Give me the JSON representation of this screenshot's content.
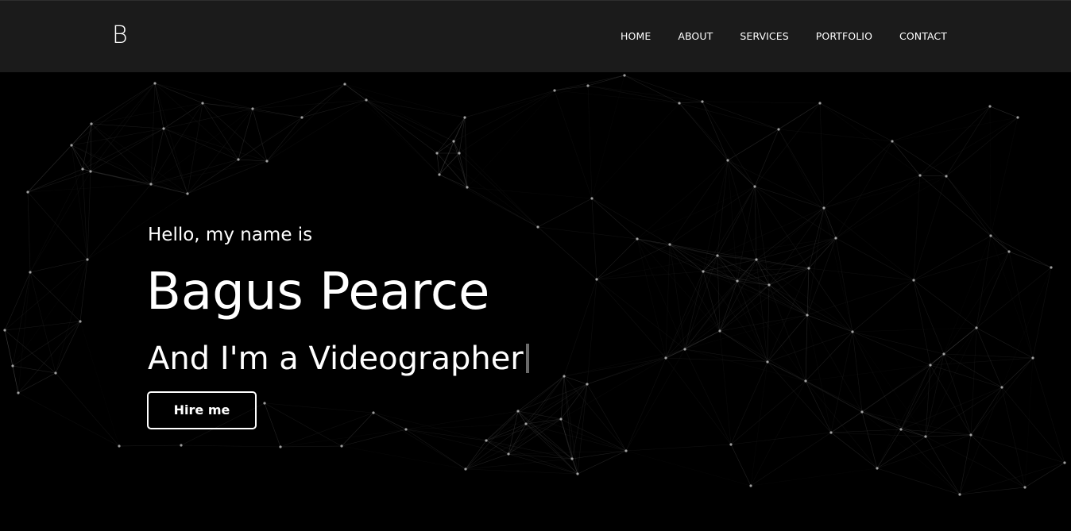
{
  "brand": {
    "logo_text": "B"
  },
  "nav": {
    "items": [
      {
        "label": "HOME"
      },
      {
        "label": "ABOUT"
      },
      {
        "label": "SERVICES"
      },
      {
        "label": "PORTFOLIO"
      },
      {
        "label": "CONTACT"
      }
    ]
  },
  "hero": {
    "greeting": "Hello, my name is",
    "name": "Bagus Pearce",
    "role_prefix": "And I'm a ",
    "role": "Videographer",
    "cta_label": "Hire me"
  },
  "colors": {
    "background": "#000000",
    "navbar": "#1b1b1b",
    "text": "#ffffff",
    "network_lines": "#8a8a8a",
    "cursor": "#6a6a6a"
  }
}
